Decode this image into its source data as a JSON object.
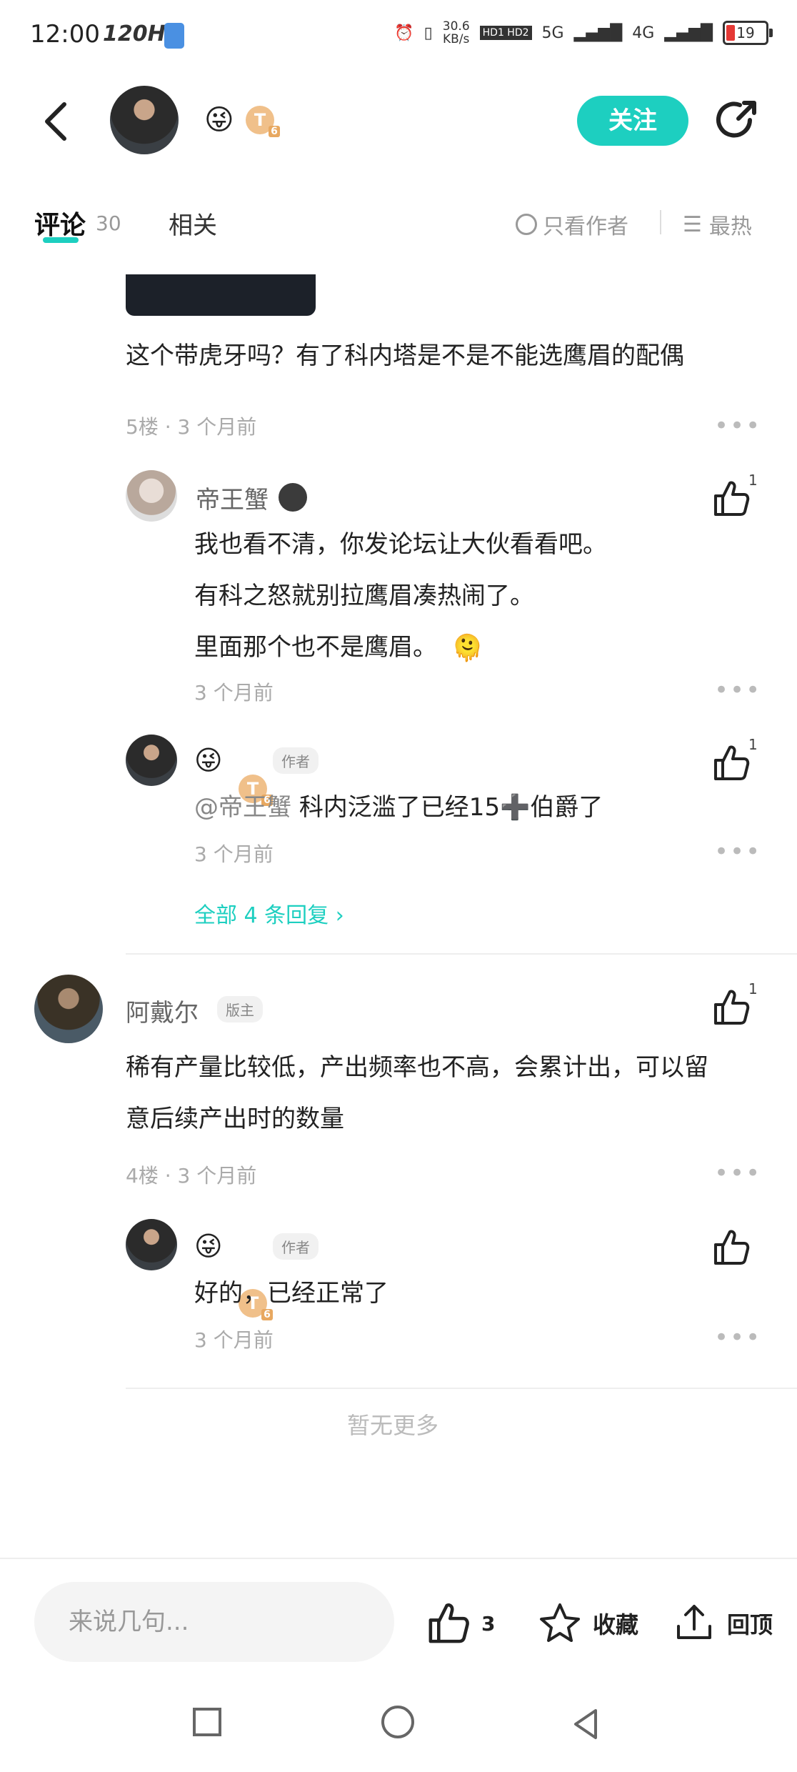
{
  "status_bar": {
    "time": "12:00",
    "refresh": "120Hz",
    "speed_top": "30.6",
    "speed_bottom": "KB/s",
    "hd": "HD1 HD2",
    "net5g": "5G",
    "net4g": "4G",
    "battery": "19"
  },
  "header": {
    "follow_label": "关注",
    "emoji": "😜",
    "badge": "T"
  },
  "tabs": {
    "comments_label": "评论",
    "comments_count": "30",
    "related_label": "相关",
    "author_only_label": "只看作者",
    "sort_label": "最热"
  },
  "comments": [
    {
      "text": "这个带虎牙吗？有了科内塔是不是不能选鹰眉的配偶",
      "meta": "5楼 · 3 个月前",
      "replies": [
        {
          "name": "帝王蟹",
          "lines": [
            "我也看不清，你发论坛让大伙看看吧。",
            "有科之怒就别拉鹰眉凑热闹了。",
            "里面那个也不是鹰眉。"
          ],
          "emoji": "🫠",
          "time": "3 个月前",
          "likes": "1"
        },
        {
          "name_emoji": "😜",
          "badge": "T",
          "author_tag": "作者",
          "mention": "@帝王蟹",
          "text": "科内泛滥了已经15➕伯爵了",
          "time": "3 个月前",
          "likes": "1"
        }
      ],
      "more_replies": "全部 4 条回复"
    },
    {
      "name": "阿戴尔",
      "role": "版主",
      "text_line1": "稀有产量比较低，产出频率也不高，会累计出，可以留",
      "text_line2": "意后续产出时的数量",
      "meta": "4楼 · 3 个月前",
      "likes": "1",
      "replies": [
        {
          "name_emoji": "😜",
          "badge": "T",
          "author_tag": "作者",
          "text": "好的，已经正常了",
          "time": "3 个月前"
        }
      ]
    }
  ],
  "no_more": "暂无更多",
  "bottom_bar": {
    "input_placeholder": "来说几句...",
    "like_count": "3",
    "favorite_label": "收藏",
    "top_label": "回顶"
  },
  "colors": {
    "accent": "#1dcfc0"
  }
}
